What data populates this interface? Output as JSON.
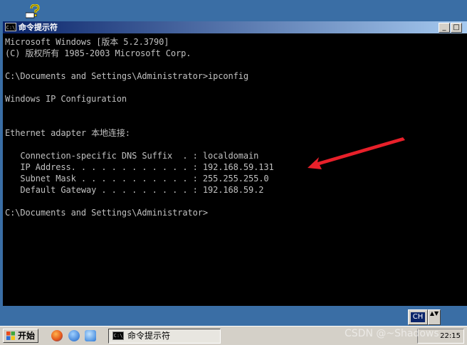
{
  "window": {
    "title": "命令提示符",
    "icon_label": "C:\\",
    "controls": {
      "minimize": "_",
      "maximize": "□"
    }
  },
  "console": {
    "lines": [
      "Microsoft Windows [版本 5.2.3790]",
      "(C) 版权所有 1985-2003 Microsoft Corp.",
      "",
      "C:\\Documents and Settings\\Administrator>ipconfig",
      "",
      "Windows IP Configuration",
      "",
      "",
      "Ethernet adapter 本地连接:",
      "",
      "   Connection-specific DNS Suffix  . : localdomain",
      "   IP Address. . . . . . . . . . . . : 192.168.59.131",
      "   Subnet Mask . . . . . . . . . . . : 255.255.255.0",
      "   Default Gateway . . . . . . . . . : 192.168.59.2",
      "",
      "C:\\Documents and Settings\\Administrator>"
    ]
  },
  "annotation": {
    "arrow_color": "#e8202a"
  },
  "language_bar": {
    "label": "CH",
    "arrows": "▲▼"
  },
  "taskbar": {
    "start_label": "开始",
    "quick_launch": [
      "firefox-icon",
      "browser-icon",
      "ie-icon"
    ],
    "tasks": [
      {
        "label": "命令提示符",
        "icon_label": "C:\\"
      }
    ],
    "clock": "22:15"
  },
  "watermark": "CSDN @~Shadows"
}
